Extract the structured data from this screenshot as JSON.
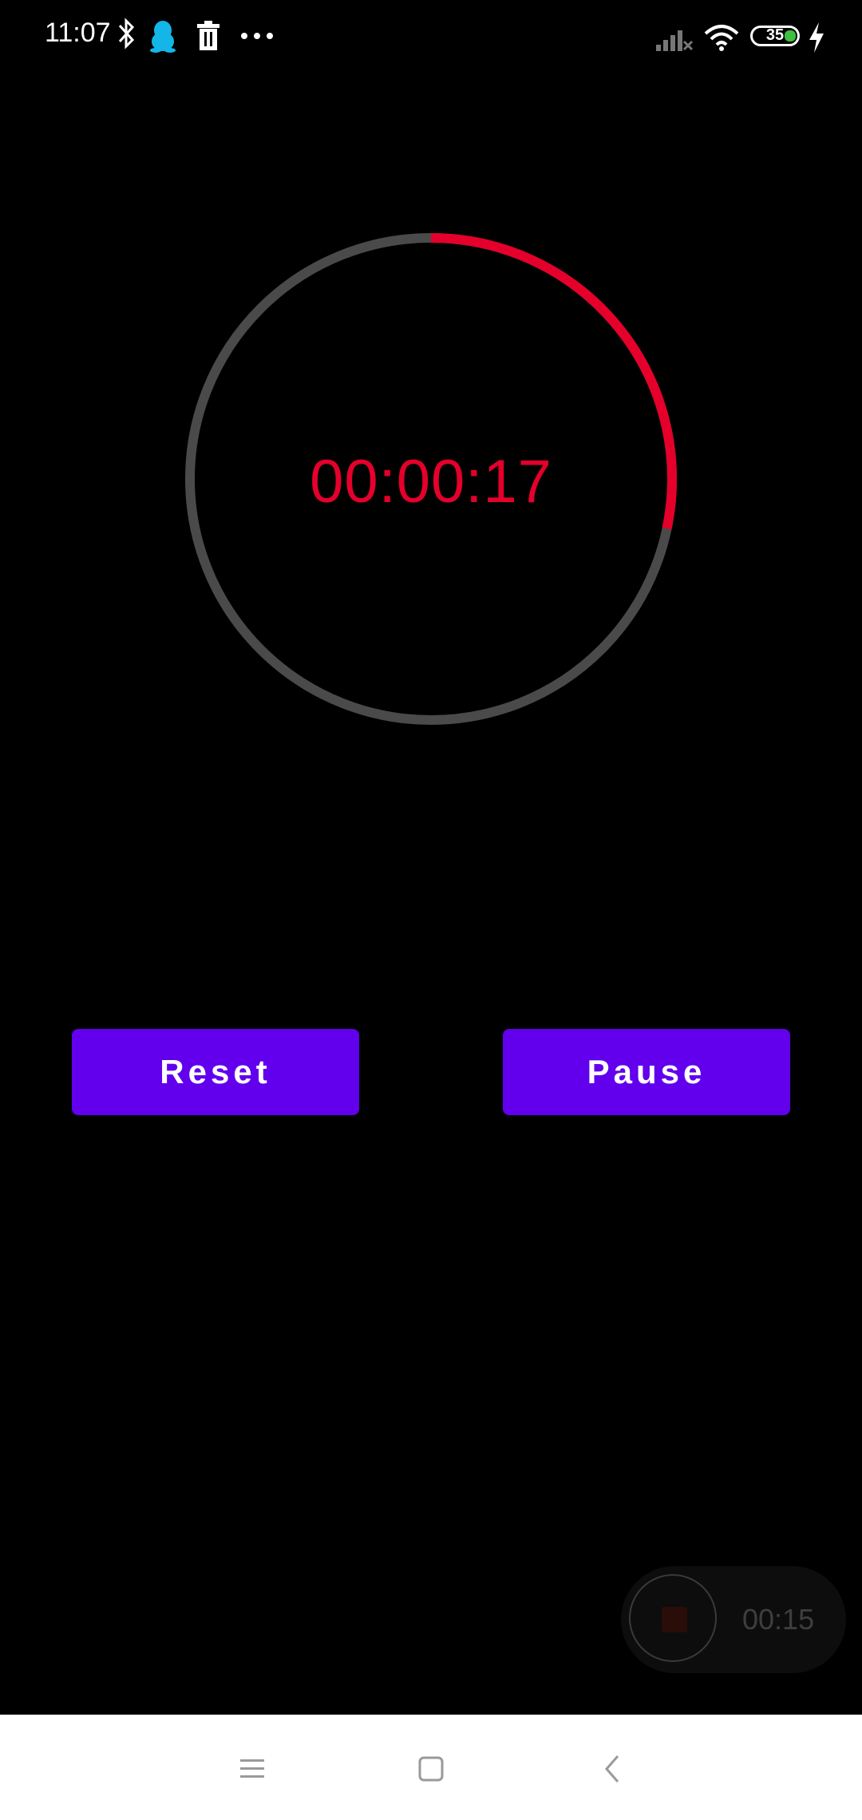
{
  "status_bar": {
    "time": "11:07",
    "battery_level": "35",
    "icons": [
      "bluetooth-icon",
      "qq-icon",
      "trash-icon",
      "more-dots-icon",
      "signal-icon",
      "wifi-icon",
      "battery-icon",
      "charging-icon"
    ]
  },
  "timer": {
    "display": "00:00:17",
    "progress_fraction": 0.283,
    "progress_color": "#e4002b",
    "track_color": "#4a4a4a"
  },
  "buttons": {
    "reset_label": "Reset",
    "pause_label": "Pause",
    "color": "#6200ee"
  },
  "recorder": {
    "elapsed": "00:15"
  },
  "nav_bar": {
    "items": [
      "menu-icon",
      "home-icon",
      "back-icon"
    ]
  }
}
